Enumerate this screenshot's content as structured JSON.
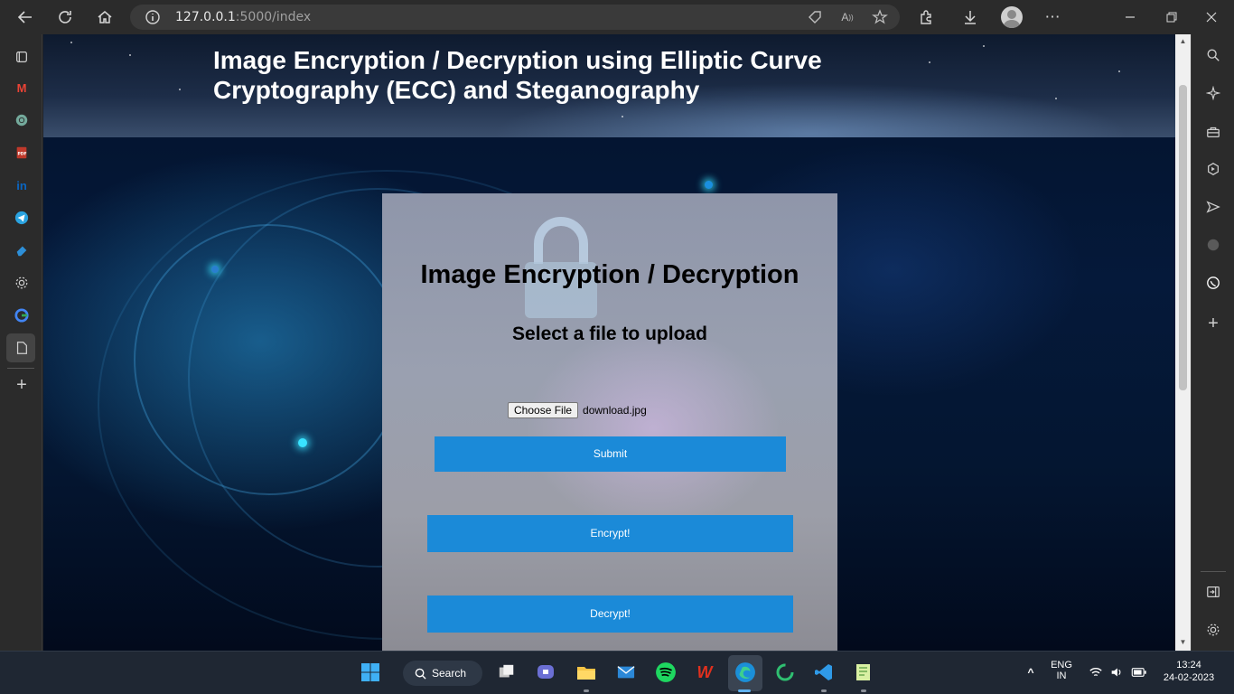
{
  "browser": {
    "url_host": "127.0.0.1",
    "url_rest": ":5000/index"
  },
  "page": {
    "header_title": "Image Encryption / Decryption using Elliptic Curve Cryptography (ECC) and Steganography",
    "panel_title": "Image Encryption / Decryption",
    "panel_subtitle": "Select a file to upload",
    "choose_file_label": "Choose File",
    "file_name": "download.jpg",
    "submit_label": "Submit",
    "encrypt_label": "Encrypt!",
    "decrypt_label": "Decrypt!"
  },
  "taskbar": {
    "search_label": "Search",
    "lang_top": "ENG",
    "lang_bottom": "IN",
    "time": "13:24",
    "date": "24-02-2023"
  },
  "colors": {
    "button_blue": "#1b8ad8",
    "browser_chrome": "#2b2b2b",
    "taskbar": "#1f2733"
  }
}
